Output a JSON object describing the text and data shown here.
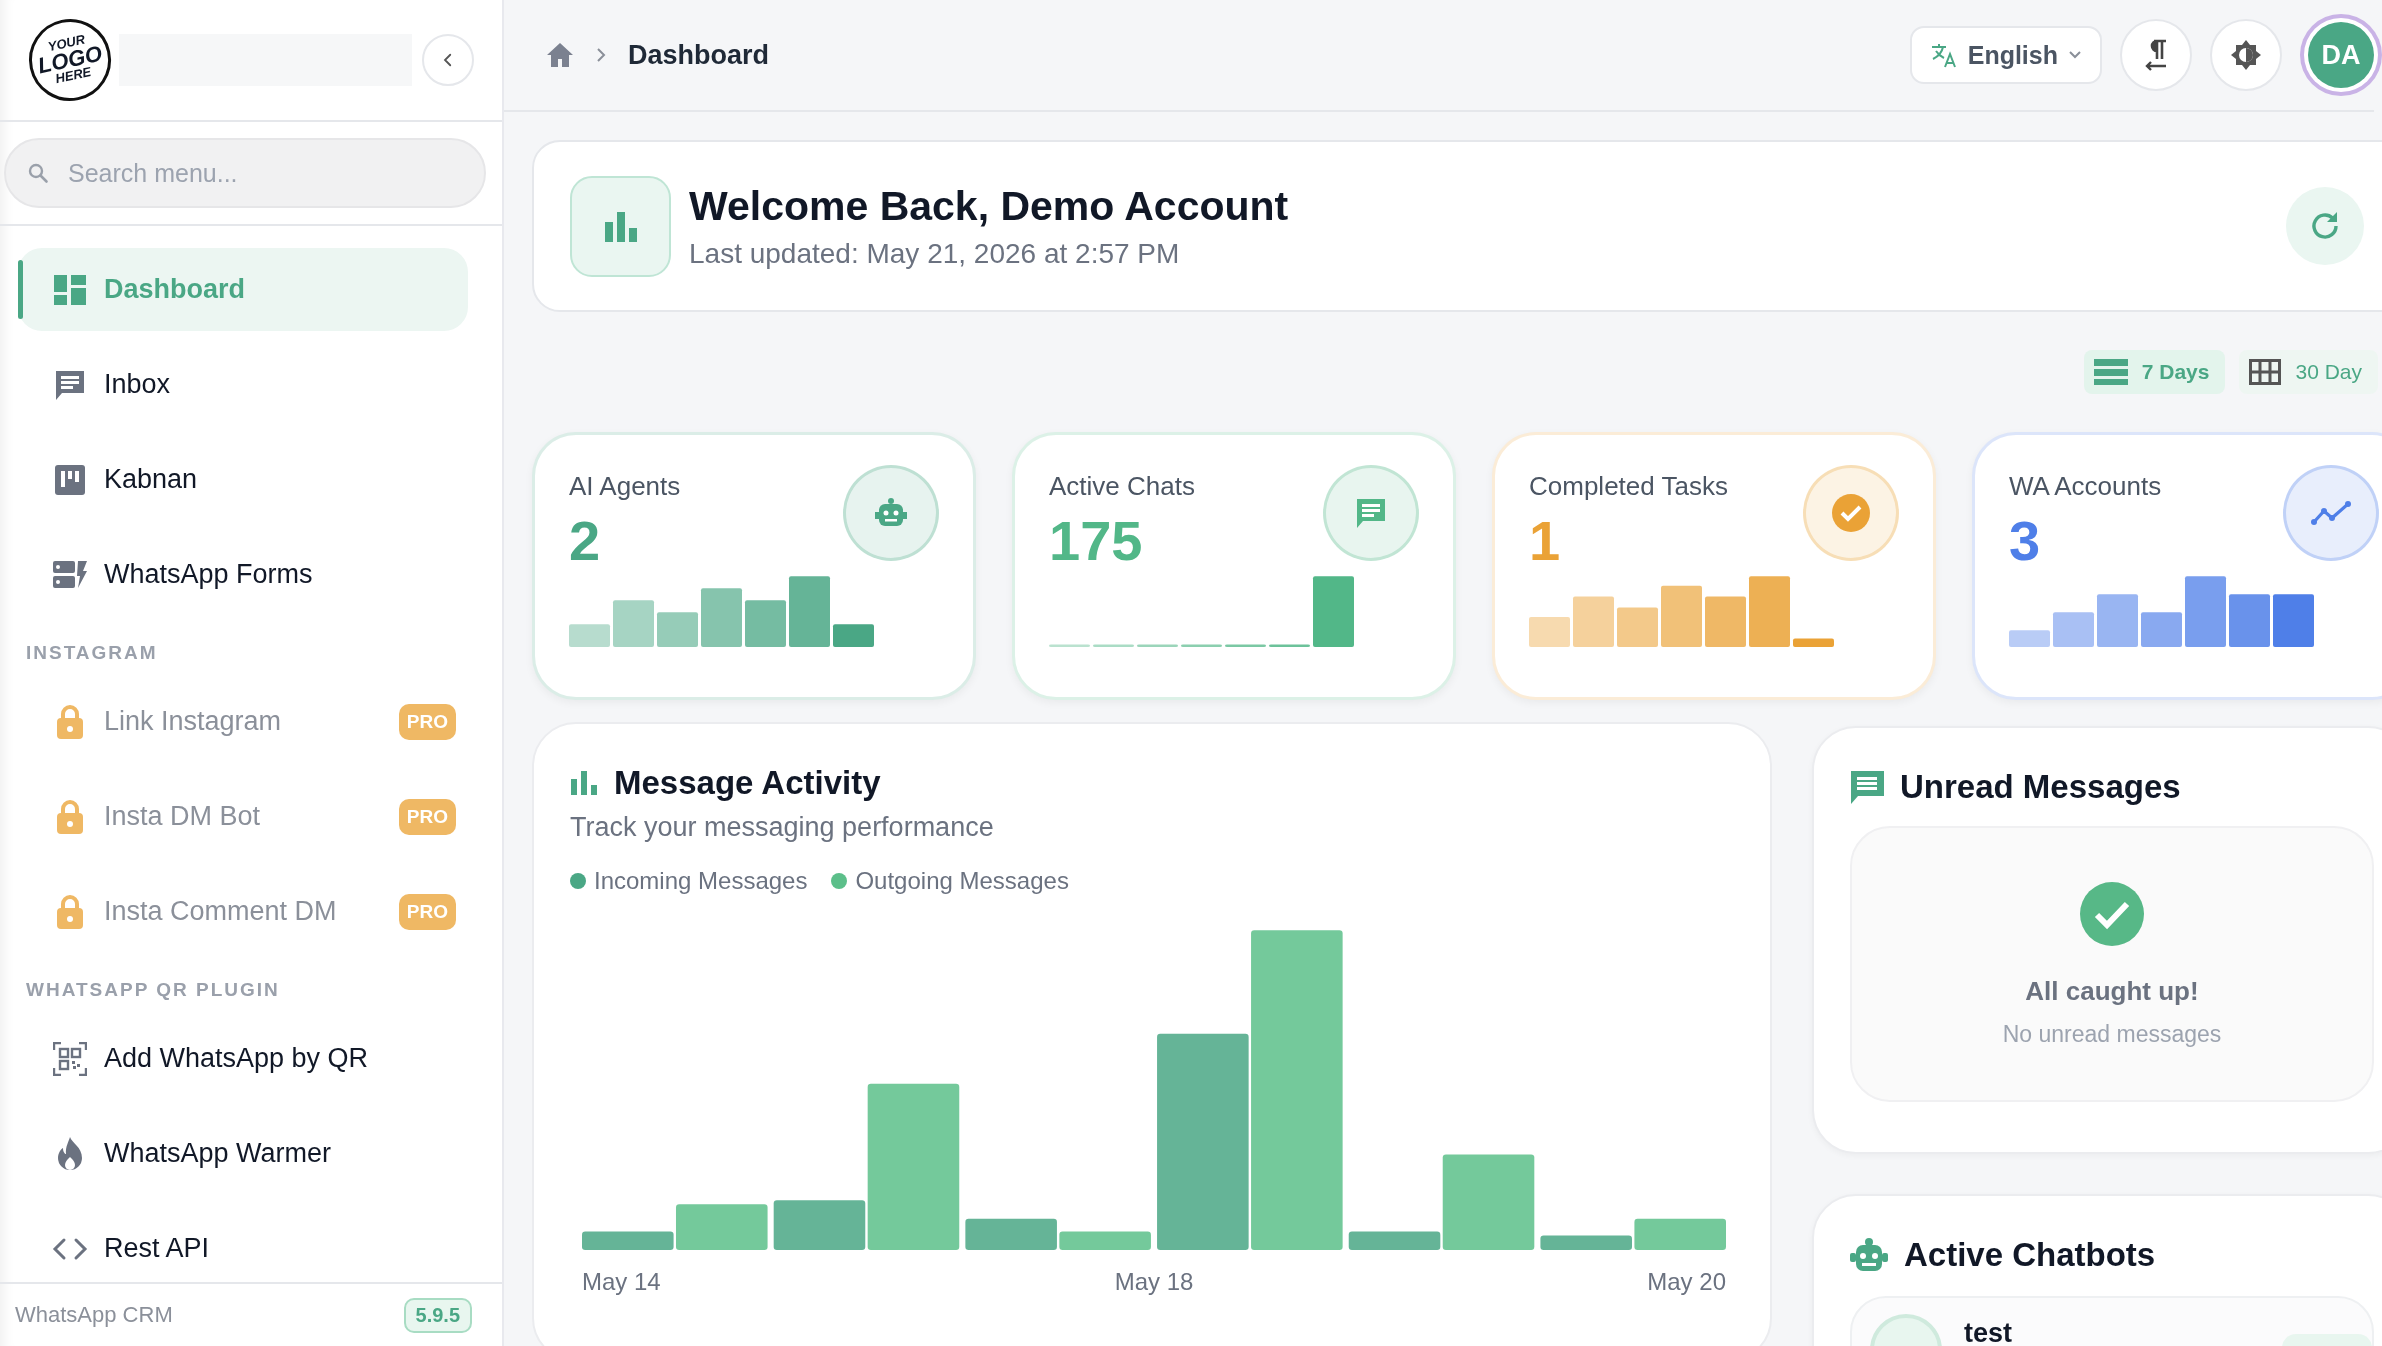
{
  "sidebar": {
    "logo_text": [
      "YOUR",
      "LOGO",
      "HERE"
    ],
    "search": {
      "placeholder": "Search menu..."
    },
    "groups": [
      {
        "items": [
          {
            "label": "Dashboard",
            "selected": true,
            "locked": false
          },
          {
            "label": "Inbox",
            "selected": false,
            "locked": false
          },
          {
            "label": "Kabnan",
            "selected": false,
            "locked": false
          },
          {
            "label": "WhatsApp Forms",
            "selected": false,
            "locked": false
          }
        ]
      },
      {
        "heading": "INSTAGRAM",
        "items": [
          {
            "label": "Link Instagram",
            "selected": false,
            "locked": true,
            "badge": "PRO"
          },
          {
            "label": "Insta DM Bot",
            "selected": false,
            "locked": true,
            "badge": "PRO"
          },
          {
            "label": "Insta Comment DM",
            "selected": false,
            "locked": true,
            "badge": "PRO"
          }
        ]
      },
      {
        "heading": "WHATSAPP QR PLUGIN",
        "items": [
          {
            "label": "Add WhatsApp by QR",
            "selected": false,
            "locked": false
          },
          {
            "label": "WhatsApp Warmer",
            "selected": false,
            "locked": false
          },
          {
            "label": "Rest API",
            "selected": false,
            "locked": false
          }
        ]
      }
    ],
    "footer": {
      "app_name": "WhatsApp CRM",
      "version": "5.9.5"
    }
  },
  "breadcrumb": {
    "current": "Dashboard"
  },
  "header": {
    "language": "English",
    "avatar": "DA"
  },
  "welcome": {
    "title": "Welcome Back, Demo Account",
    "subtitle": "Last updated: May 21, 2026 at 2:57 PM"
  },
  "ranges": [
    {
      "label": "7 Days",
      "selected": true
    },
    {
      "label": "30 Day",
      "selected": false
    }
  ],
  "stats": [
    {
      "label": "AI Agents",
      "value": "2",
      "color": "#4aa785"
    },
    {
      "label": "Active Chats",
      "value": "175",
      "color": "#52b788"
    },
    {
      "label": "Completed Tasks",
      "value": "1",
      "color": "#eaa236"
    },
    {
      "label": "WA Accounts",
      "value": "3",
      "color": "#4f7fe8"
    }
  ],
  "activity": {
    "title": "Message Activity",
    "subtitle": "Track your messaging performance",
    "legend": [
      {
        "label": "Incoming Messages",
        "color": "#4aa785"
      },
      {
        "label": "Outgoing Messages",
        "color": "#5cbf8a"
      }
    ],
    "x_labels": [
      "May 14",
      "May 18",
      "May 20"
    ]
  },
  "unread": {
    "title": "Unread Messages",
    "empty_title": "All caught up!",
    "empty_text": "No unread messages"
  },
  "chatbots": {
    "title": "Active Chatbots",
    "items": [
      {
        "name": "test"
      }
    ]
  }
}
